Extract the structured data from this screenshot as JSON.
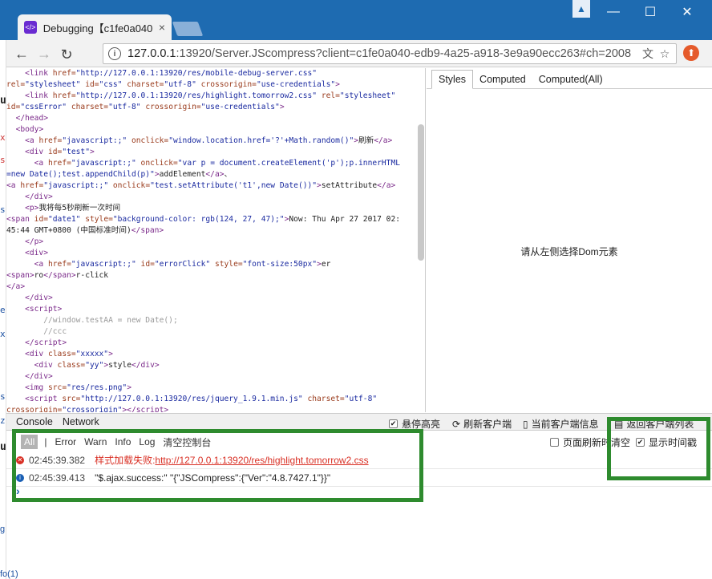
{
  "browser": {
    "tab_title": "Debugging【c1fe0a040",
    "url_host": "127.0.0.1",
    "url_rest": ":13920/Server.JScompress?client=c1fe0a040-edb9-4a25-a918-3e9a90ecc263#ch=2008",
    "info_icon": "i"
  },
  "dom_lines": [
    {
      "indent": "    ",
      "html": "<span class='tg'>&lt;link</span> <span class='at'>href=</span><span class='av'>\"http://127.0.0.1:13920/res/mobile-debug-server.css\"</span>"
    },
    {
      "indent": "",
      "html": "<span class='at'>rel=</span><span class='av'>\"stylesheet\"</span> <span class='at'>id=</span><span class='av'>\"css\"</span> <span class='at'>charset=</span><span class='av'>\"utf-8\"</span> <span class='at'>crossorigin=</span><span class='av'>\"use-credentials\"</span><span class='tg'>&gt;</span>"
    },
    {
      "indent": "    ",
      "html": "<span class='tg'>&lt;link</span> <span class='at'>href=</span><span class='av'>\"http://127.0.0.1:13920/res/highlight.tomorrow2.css\"</span> <span class='at'>rel=</span><span class='av'>\"stylesheet\"</span>"
    },
    {
      "indent": "",
      "html": "<span class='at'>id=</span><span class='av'>\"cssError\"</span> <span class='at'>charset=</span><span class='av'>\"utf-8\"</span> <span class='at'>crossorigin=</span><span class='av'>\"use-credentials\"</span><span class='tg'>&gt;</span>"
    },
    {
      "indent": "  ",
      "html": "<span class='tg'>&lt;/head&gt;</span>"
    },
    {
      "indent": "  ",
      "html": "<span class='tg'>&lt;body&gt;</span>"
    },
    {
      "indent": "    ",
      "html": "<span class='tg'>&lt;a</span> <span class='at'>href=</span><span class='av'>\"javascript:;\"</span> <span class='at'>onclick=</span><span class='av'>\"window.location.href='?'+Math.random()\"</span><span class='tg'>&gt;</span>刷新<span class='tg'>&lt;/a&gt;</span>"
    },
    {
      "indent": "    ",
      "html": "<span class='tg'>&lt;div</span> <span class='at'>id=</span><span class='av'>\"test\"</span><span class='tg'>&gt;</span>"
    },
    {
      "indent": "      ",
      "html": "<span class='tg'>&lt;a</span> <span class='at'>href=</span><span class='av'>\"javascript:;\"</span> <span class='at'>onclick=</span><span class='av'>\"var p = document.createElement('p');p.innerHTML</span>"
    },
    {
      "indent": "",
      "html": "<span class='av'>=new Date();test.appendChild(p)\"</span><span class='tg'>&gt;</span>addElement<span class='tg'>&lt;/a&gt;</span>、"
    },
    {
      "indent": "",
      "html": "<span class='tg'>&lt;a</span> <span class='at'>href=</span><span class='av'>\"javascript:;\"</span> <span class='at'>onclick=</span><span class='av'>\"test.setAttribute('t1',new Date())\"</span><span class='tg'>&gt;</span>setAttribute<span class='tg'>&lt;/a&gt;</span>"
    },
    {
      "indent": "    ",
      "html": "<span class='tg'>&lt;/div&gt;</span>"
    },
    {
      "indent": "    ",
      "html": "<span class='tg'>&lt;p&gt;</span>我将每5秒刷新一次时间"
    },
    {
      "indent": "",
      "html": "<span class='tg'>&lt;span</span> <span class='at'>id=</span><span class='av'>\"date1\"</span> <span class='at'>style=</span><span class='av'>\"background-color: rgb(124, 27, 47);\"</span><span class='tg'>&gt;</span>Now: Thu Apr 27 2017 02:"
    },
    {
      "indent": "",
      "html": "45:44 GMT+0800 (中国标准时间)<span class='tg'>&lt;/span&gt;</span>"
    },
    {
      "indent": "    ",
      "html": "<span class='tg'>&lt;/p&gt;</span>"
    },
    {
      "indent": "    ",
      "html": "<span class='tg'>&lt;div&gt;</span>"
    },
    {
      "indent": "      ",
      "html": "<span class='tg'>&lt;a</span> <span class='at'>href=</span><span class='av'>\"javascript:;\"</span> <span class='at'>id=</span><span class='av'>\"errorClick\"</span> <span class='at'>style=</span><span class='av'>\"font-size:50px\"</span><span class='tg'>&gt;</span>er"
    },
    {
      "indent": "",
      "html": "<span class='tg'>&lt;span&gt;</span>ro<span class='tg'>&lt;/span&gt;</span>r-click"
    },
    {
      "indent": "",
      "html": "<span class='tg'>&lt;/a&gt;</span>"
    },
    {
      "indent": "    ",
      "html": "<span class='tg'>&lt;/div&gt;</span>"
    },
    {
      "indent": "    ",
      "html": "<span class='tg'>&lt;script&gt;</span>"
    },
    {
      "indent": "        ",
      "html": "<span class='cm'>//window.testAA = new Date();</span>"
    },
    {
      "indent": "        ",
      "html": "<span class='cm'>//ccc</span>"
    },
    {
      "indent": "    ",
      "html": "<span class='tg'>&lt;/script&gt;</span>"
    },
    {
      "indent": "    ",
      "html": "<span class='tg'>&lt;div</span> <span class='at'>class=</span><span class='av'>\"xxxxx\"</span><span class='tg'>&gt;</span>"
    },
    {
      "indent": "      ",
      "html": "<span class='tg'>&lt;div</span> <span class='at'>class=</span><span class='av'>\"yy\"</span><span class='tg'>&gt;</span>style<span class='tg'>&lt;/div&gt;</span>"
    },
    {
      "indent": "    ",
      "html": "<span class='tg'>&lt;/div&gt;</span>"
    },
    {
      "indent": "    ",
      "html": "<span class='tg'>&lt;img</span> <span class='at'>src=</span><span class='av'>\"res/res.png\"</span><span class='tg'>&gt;</span>"
    },
    {
      "indent": "    ",
      "html": "<span class='tg'>&lt;script</span> <span class='at'>src=</span><span class='av'>\"http://127.0.0.1:13920/res/jquery_1.9.1.min.js\"</span> <span class='at'>charset=</span><span class='av'>\"utf-8\"</span>"
    },
    {
      "indent": "",
      "html": "<span class='at'>crossorigin=</span><span class='av'>\"crossorigin\"</span><span class='tg'>&gt;&lt;/script&gt;</span>"
    }
  ],
  "styles": {
    "tabs": [
      "Styles",
      "Computed",
      "Computed(All)"
    ],
    "empty_hint": "请从左侧选择Dom元素"
  },
  "console": {
    "tabs": [
      "Console",
      "Network"
    ],
    "pause_highlight": "悬停高亮",
    "refresh_client": "刷新客户端",
    "client_info": "当前客户端信息",
    "back_to_list": "返回客户端列表",
    "filters": [
      "All",
      "|",
      "Error",
      "Warn",
      "Info",
      "Log",
      "清空控制台"
    ],
    "clear_on_refresh": "页面刷新时清空",
    "show_timestamp": "显示时间戳",
    "logs": [
      {
        "type": "error",
        "time": "02:45:39.382",
        "msg": "样式加载失败:",
        "link": "http://127.0.0.1:13920/res/highlight.tomorrow2.css"
      },
      {
        "type": "info",
        "time": "02:45:39.413",
        "msg": "\"$.ajax.success:\"  \"{\"JSCompress\":{\"Ver\":\"4.8.7427.1\"}}\""
      }
    ],
    "prompt": "›"
  },
  "colors": {
    "titlebar": "#1e6bb1",
    "highlight_box": "#2e8b2e",
    "error": "#d93025",
    "info": "#1a5fb4"
  }
}
